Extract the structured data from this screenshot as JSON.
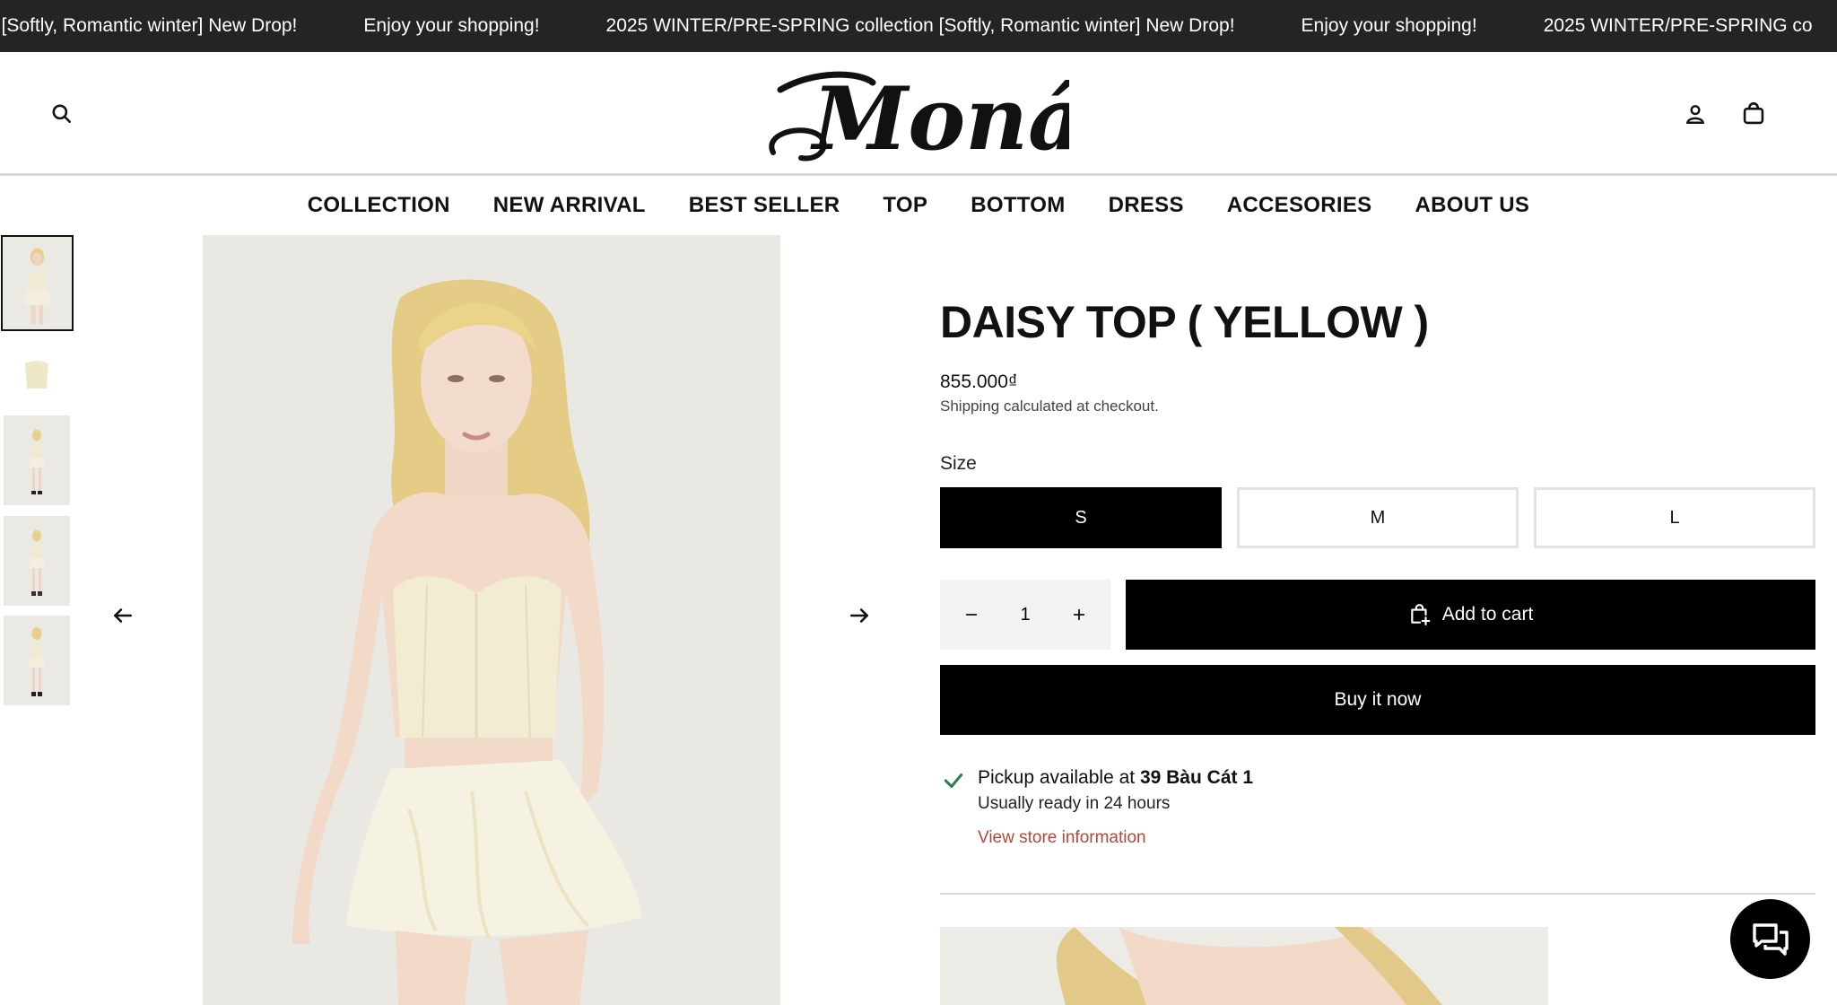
{
  "announcement": {
    "items": [
      "n [Softly, Romantic winter] New Drop!",
      "Enjoy your shopping!",
      "2025 WINTER/PRE-SPRING collection [Softly, Romantic winter] New Drop!",
      "Enjoy your shopping!",
      "2025 WINTER/PRE-SPRING co"
    ]
  },
  "header": {
    "logo_text": "Moná",
    "icons": {
      "search": "search-icon",
      "account": "user-icon",
      "cart": "shopping-bag-icon"
    }
  },
  "nav": {
    "items": [
      "COLLECTION",
      "NEW ARRIVAL",
      "BEST SELLER",
      "TOP",
      "BOTTOM",
      "DRESS",
      "ACCESORIES",
      "ABOUT US"
    ]
  },
  "gallery": {
    "thumbnail_count": 5,
    "active_index": 0,
    "prev_icon": "arrow-left-icon",
    "next_icon": "arrow-right-icon"
  },
  "product": {
    "title": "DAISY TOP ( YELLOW )",
    "price": "855.000₫",
    "shipping_link": "Shipping",
    "shipping_text": " calculated at checkout.",
    "size_label": "Size",
    "sizes": [
      "S",
      "M",
      "L"
    ],
    "selected_size": "S",
    "quantity": "1",
    "add_to_cart": "Add to cart",
    "buy_now": "Buy it now"
  },
  "pickup": {
    "prefix": "Pickup available at ",
    "store": "39 Bàu Cát 1",
    "ready": "Usually ready in 24 hours",
    "store_link": "View store information"
  },
  "colors": {
    "announcement_bg": "#242424",
    "accent_link": "#b5453a",
    "button_bg": "#000000",
    "check": "#2e7d4f"
  },
  "chat": {
    "icon": "chat-bubbles-icon"
  }
}
